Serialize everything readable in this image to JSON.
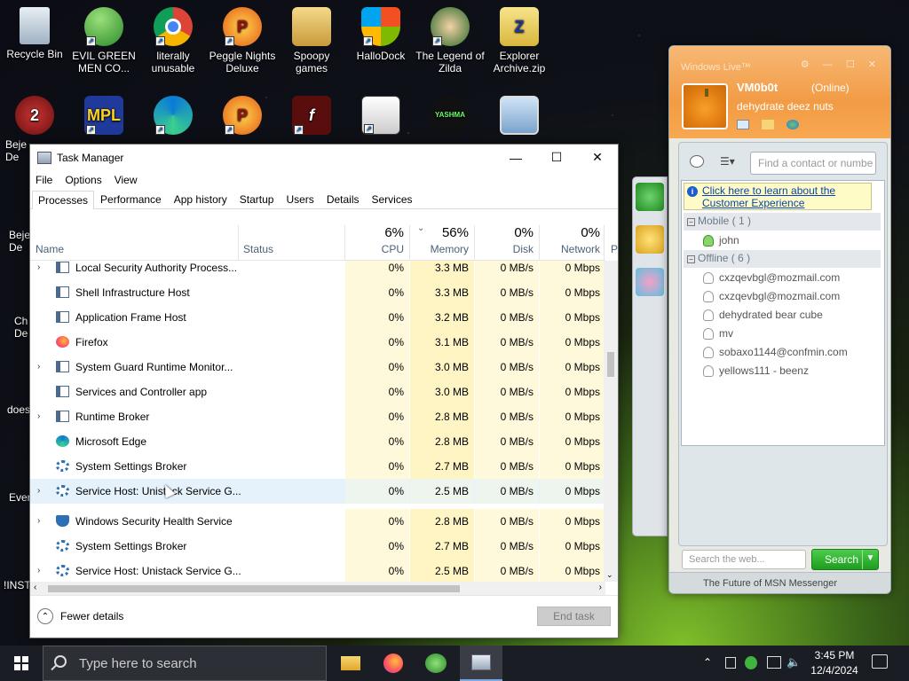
{
  "desktop": {
    "icons": [
      {
        "label": "Recycle Bin"
      },
      {
        "label": "EVIL GREEN MEN CO..."
      },
      {
        "label": "literally unusable"
      },
      {
        "label": "Peggle Nights Deluxe"
      },
      {
        "label": "Spoopy games"
      },
      {
        "label": "HalloDock"
      },
      {
        "label": "The Legend of Zilda"
      },
      {
        "label": "Explorer Archive.zip"
      }
    ],
    "left_edge_labels": [
      "Beje",
      "De",
      "Beje",
      "De",
      "Ch",
      "De",
      "does",
      "Ever",
      "!INSTA"
    ]
  },
  "task_manager": {
    "title": "Task Manager",
    "menu": [
      "File",
      "Options",
      "View"
    ],
    "tabs": [
      "Processes",
      "Performance",
      "App history",
      "Startup",
      "Users",
      "Details",
      "Services"
    ],
    "columns": {
      "name": "Name",
      "status": "Status",
      "cpu_pct": "6%",
      "cpu": "CPU",
      "memory_pct": "56%",
      "memory": "Memory",
      "disk_pct": "0%",
      "disk": "Disk",
      "network_pct": "0%",
      "network": "Network",
      "power": "P"
    },
    "rows": [
      {
        "name": "Local Security Authority Process...",
        "cpu": "0%",
        "memory": "3.3 MB",
        "disk": "0 MB/s",
        "network": "0 Mbps",
        "expand": true,
        "icon": "service-icon"
      },
      {
        "name": "Shell Infrastructure Host",
        "cpu": "0%",
        "memory": "3.3 MB",
        "disk": "0 MB/s",
        "network": "0 Mbps",
        "expand": false,
        "icon": "service-icon"
      },
      {
        "name": "Application Frame Host",
        "cpu": "0%",
        "memory": "3.2 MB",
        "disk": "0 MB/s",
        "network": "0 Mbps",
        "expand": false,
        "icon": "service-icon"
      },
      {
        "name": "Firefox",
        "cpu": "0%",
        "memory": "3.1 MB",
        "disk": "0 MB/s",
        "network": "0 Mbps",
        "expand": false,
        "icon": "firefox-icon"
      },
      {
        "name": "System Guard Runtime Monitor...",
        "cpu": "0%",
        "memory": "3.0 MB",
        "disk": "0 MB/s",
        "network": "0 Mbps",
        "expand": true,
        "icon": "service-icon"
      },
      {
        "name": "Services and Controller app",
        "cpu": "0%",
        "memory": "3.0 MB",
        "disk": "0 MB/s",
        "network": "0 Mbps",
        "expand": false,
        "icon": "service-icon"
      },
      {
        "name": "Runtime Broker",
        "cpu": "0%",
        "memory": "2.8 MB",
        "disk": "0 MB/s",
        "network": "0 Mbps",
        "expand": true,
        "icon": "service-icon"
      },
      {
        "name": "Microsoft Edge",
        "cpu": "0%",
        "memory": "2.8 MB",
        "disk": "0 MB/s",
        "network": "0 Mbps",
        "expand": false,
        "icon": "edge-icon"
      },
      {
        "name": "System Settings Broker",
        "cpu": "0%",
        "memory": "2.7 MB",
        "disk": "0 MB/s",
        "network": "0 Mbps",
        "expand": false,
        "icon": "gear-icon"
      },
      {
        "name": "Service Host: Unistack Service G...",
        "cpu": "0%",
        "memory": "2.5 MB",
        "disk": "0 MB/s",
        "network": "0 Mbps",
        "expand": true,
        "icon": "gear-icon"
      },
      {
        "name": "Windows Security Health Service",
        "cpu": "0%",
        "memory": "2.8 MB",
        "disk": "0 MB/s",
        "network": "0 Mbps",
        "expand": true,
        "icon": "shield-icon"
      },
      {
        "name": "System Settings Broker",
        "cpu": "0%",
        "memory": "2.7 MB",
        "disk": "0 MB/s",
        "network": "0 Mbps",
        "expand": false,
        "icon": "gear-icon"
      },
      {
        "name": "Service Host: Unistack Service G...",
        "cpu": "0%",
        "memory": "2.5 MB",
        "disk": "0 MB/s",
        "network": "0 Mbps",
        "expand": true,
        "icon": "gear-icon"
      }
    ],
    "fewer_details": "Fewer details",
    "end_task": "End task"
  },
  "messenger": {
    "title": "Windows Live™",
    "user": "VM0b0t",
    "status": "(Online)",
    "personal_message": "dehydrate deez nuts",
    "search_placeholder": "Find a contact or numbe",
    "banner": "Click here to learn about the Customer Experience",
    "group_mobile": "Mobile ( 1 )",
    "group_offline": "Offline ( 6 )",
    "mobile_contacts": [
      "john"
    ],
    "offline_contacts": [
      "cxzqevbgl@mozmail.com",
      "cxzqevbgl@mozmail.com",
      "dehydrated bear cube",
      "mv",
      "sobaxo1144@confmin.com",
      "yellows111 - beenz"
    ],
    "web_search_placeholder": "Search the web...",
    "search_button": "Search",
    "footer": "The Future of MSN Messenger"
  },
  "taskbar": {
    "search_placeholder": "Type here to search",
    "time": "3:45 PM",
    "date": "12/4/2024"
  }
}
